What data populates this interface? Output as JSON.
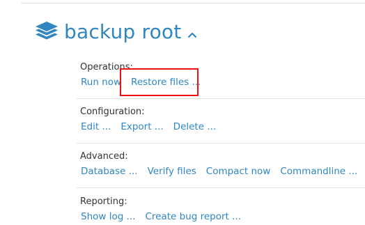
{
  "backup": {
    "title": "backup root"
  },
  "sections": [
    {
      "label": "Operations:",
      "links": [
        "Run now",
        "Restore files ..."
      ]
    },
    {
      "label": "Configuration:",
      "links": [
        "Edit ...",
        "Export ...",
        "Delete ..."
      ]
    },
    {
      "label": "Advanced:",
      "links": [
        "Database ...",
        "Verify files",
        "Compact now",
        "Commandline ..."
      ]
    },
    {
      "label": "Reporting:",
      "links": [
        "Show log ...",
        "Create bug report ..."
      ]
    }
  ],
  "colors": {
    "accent": "#2f86c1",
    "highlight": "#ee1111",
    "label_text": "#333333",
    "divider": "#e2e2e2"
  },
  "icons": {
    "backup_icon": "layers-stack-icon",
    "toggle_icon": "chevron-up-icon"
  }
}
